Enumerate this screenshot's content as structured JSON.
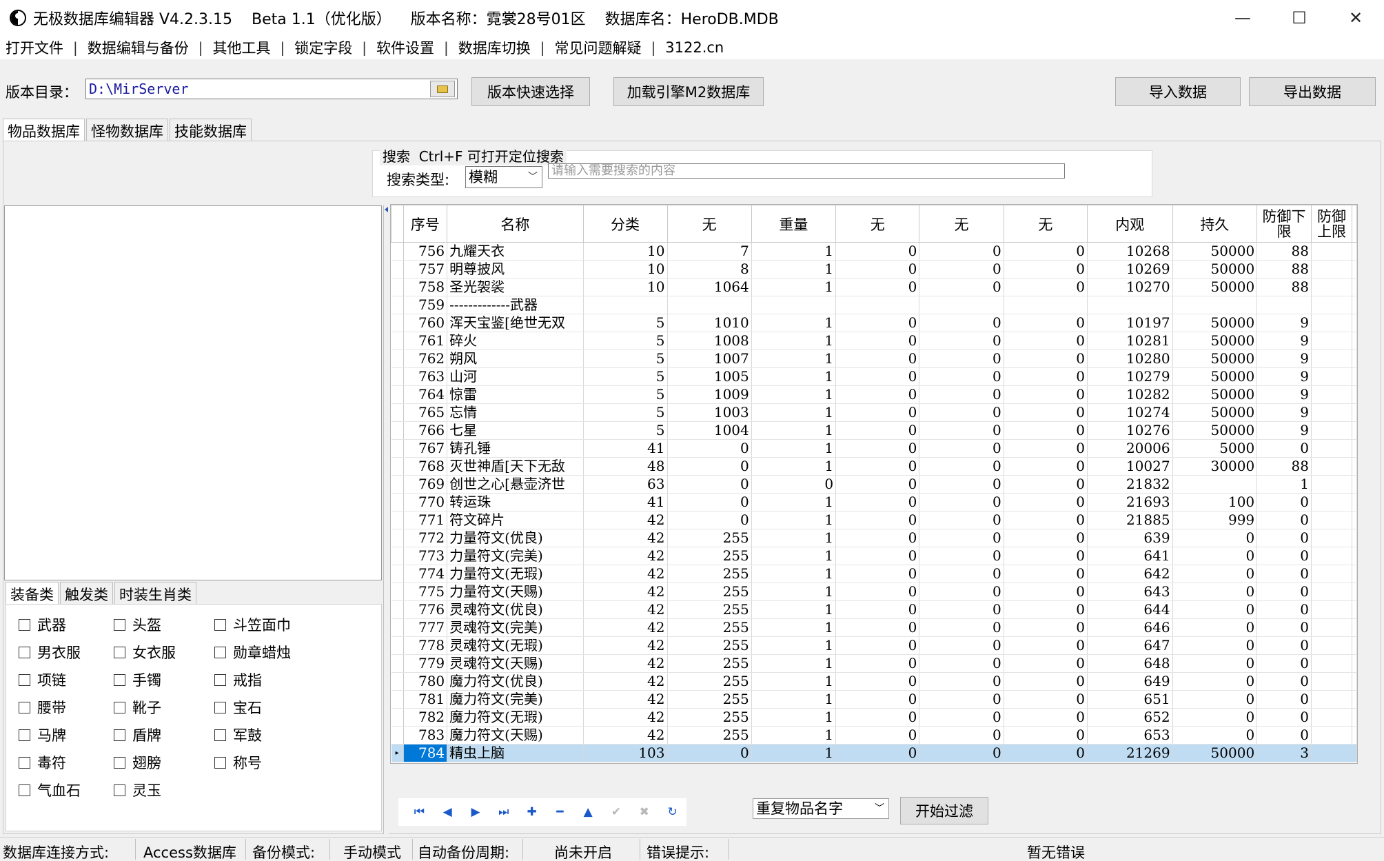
{
  "window": {
    "title": "无极数据库编辑器 V4.2.3.15    Beta 1.1（优化版）    版本名称：霓裳28号01区    数据库名：HeroDB.MDB",
    "minimize": "—",
    "maximize": "☐",
    "close": "✕"
  },
  "menu": [
    "打开文件",
    "数据编辑与备份",
    "其他工具",
    "锁定字段",
    "软件设置",
    "数据库切换",
    "常见问题解疑",
    "3122.cn"
  ],
  "toolbar": {
    "dir_label": "版本目录：",
    "dir_value": "D:\\MirServer",
    "quick_select": "版本快速选择",
    "load_m2": "加载引擎M2数据库",
    "import": "导入数据",
    "export": "导出数据"
  },
  "tabs": [
    "物品数据库",
    "怪物数据库",
    "技能数据库"
  ],
  "search": {
    "title": "搜索  Ctrl+F 可打开定位搜索",
    "type_label": "搜索类型:",
    "type_value": "模糊",
    "placeholder": "请输入需要搜索的内容"
  },
  "category_tabs": [
    "装备类",
    "触发类",
    "时装生肖类"
  ],
  "checkboxes": [
    "武器",
    "头盔",
    "斗笠面巾",
    "男衣服",
    "女衣服",
    "勋章蜡烛",
    "项链",
    "手镯",
    "戒指",
    "腰带",
    "靴子",
    "宝石",
    "马牌",
    "盾牌",
    "军鼓",
    "毒符",
    "翅膀",
    "称号",
    "气血石",
    "灵玉"
  ],
  "grid": {
    "headers": [
      "序号",
      "名称",
      "分类",
      "无",
      "重量",
      "无",
      "无",
      "无",
      "内观",
      "持久",
      "防御下限",
      "防御上限"
    ],
    "rows": [
      [
        "756",
        "九耀天衣",
        "10",
        "7",
        "1",
        "0",
        "0",
        "0",
        "10268",
        "50000",
        "88",
        ""
      ],
      [
        "757",
        "明尊披风",
        "10",
        "8",
        "1",
        "0",
        "0",
        "0",
        "10269",
        "50000",
        "88",
        ""
      ],
      [
        "758",
        "圣光袈裟",
        "10",
        "1064",
        "1",
        "0",
        "0",
        "0",
        "10270",
        "50000",
        "88",
        ""
      ],
      [
        "759",
        "-------------武器",
        "",
        "",
        "",
        "",
        "",
        "",
        "",
        "",
        "",
        ""
      ],
      [
        "760",
        "浑天宝鉴[绝世无双",
        "5",
        "1010",
        "1",
        "0",
        "0",
        "0",
        "10197",
        "50000",
        "9",
        ""
      ],
      [
        "761",
        "碎火",
        "5",
        "1008",
        "1",
        "0",
        "0",
        "0",
        "10281",
        "50000",
        "9",
        ""
      ],
      [
        "762",
        "朔风",
        "5",
        "1007",
        "1",
        "0",
        "0",
        "0",
        "10280",
        "50000",
        "9",
        ""
      ],
      [
        "763",
        "山河",
        "5",
        "1005",
        "1",
        "0",
        "0",
        "0",
        "10279",
        "50000",
        "9",
        ""
      ],
      [
        "764",
        "惊雷",
        "5",
        "1009",
        "1",
        "0",
        "0",
        "0",
        "10282",
        "50000",
        "9",
        ""
      ],
      [
        "765",
        "忘情",
        "5",
        "1003",
        "1",
        "0",
        "0",
        "0",
        "10274",
        "50000",
        "9",
        ""
      ],
      [
        "766",
        "七星",
        "5",
        "1004",
        "1",
        "0",
        "0",
        "0",
        "10276",
        "50000",
        "9",
        ""
      ],
      [
        "767",
        "铸孔锤",
        "41",
        "0",
        "1",
        "0",
        "0",
        "0",
        "20006",
        "5000",
        "0",
        ""
      ],
      [
        "768",
        "灭世神盾[天下无敌",
        "48",
        "0",
        "1",
        "0",
        "0",
        "0",
        "10027",
        "30000",
        "88",
        ""
      ],
      [
        "769",
        "创世之心[悬壶济世",
        "63",
        "0",
        "0",
        "0",
        "0",
        "0",
        "21832",
        "",
        "1",
        ""
      ],
      [
        "770",
        "转运珠",
        "41",
        "0",
        "1",
        "0",
        "0",
        "0",
        "21693",
        "100",
        "0",
        ""
      ],
      [
        "771",
        "符文碎片",
        "42",
        "0",
        "1",
        "0",
        "0",
        "0",
        "21885",
        "999",
        "0",
        ""
      ],
      [
        "772",
        "力量符文(优良)",
        "42",
        "255",
        "1",
        "0",
        "0",
        "0",
        "639",
        "0",
        "0",
        ""
      ],
      [
        "773",
        "力量符文(完美)",
        "42",
        "255",
        "1",
        "0",
        "0",
        "0",
        "641",
        "0",
        "0",
        ""
      ],
      [
        "774",
        "力量符文(无瑕)",
        "42",
        "255",
        "1",
        "0",
        "0",
        "0",
        "642",
        "0",
        "0",
        ""
      ],
      [
        "775",
        "力量符文(天赐)",
        "42",
        "255",
        "1",
        "0",
        "0",
        "0",
        "643",
        "0",
        "0",
        ""
      ],
      [
        "776",
        "灵魂符文(优良)",
        "42",
        "255",
        "1",
        "0",
        "0",
        "0",
        "644",
        "0",
        "0",
        ""
      ],
      [
        "777",
        "灵魂符文(完美)",
        "42",
        "255",
        "1",
        "0",
        "0",
        "0",
        "646",
        "0",
        "0",
        ""
      ],
      [
        "778",
        "灵魂符文(无瑕)",
        "42",
        "255",
        "1",
        "0",
        "0",
        "0",
        "647",
        "0",
        "0",
        ""
      ],
      [
        "779",
        "灵魂符文(天赐)",
        "42",
        "255",
        "1",
        "0",
        "0",
        "0",
        "648",
        "0",
        "0",
        ""
      ],
      [
        "780",
        "魔力符文(优良)",
        "42",
        "255",
        "1",
        "0",
        "0",
        "0",
        "649",
        "0",
        "0",
        ""
      ],
      [
        "781",
        "魔力符文(完美)",
        "42",
        "255",
        "1",
        "0",
        "0",
        "0",
        "651",
        "0",
        "0",
        ""
      ],
      [
        "782",
        "魔力符文(无瑕)",
        "42",
        "255",
        "1",
        "0",
        "0",
        "0",
        "652",
        "0",
        "0",
        ""
      ],
      [
        "783",
        "魔力符文(天赐)",
        "42",
        "255",
        "1",
        "0",
        "0",
        "0",
        "653",
        "0",
        "0",
        ""
      ],
      [
        "784",
        "精虫上脑",
        "103",
        "0",
        "1",
        "0",
        "0",
        "0",
        "21269",
        "50000",
        "3",
        ""
      ]
    ],
    "selected_index": 28
  },
  "navigator": [
    {
      "icon": "first-record-icon",
      "glyph": "⏮",
      "enabled": true
    },
    {
      "icon": "prior-record-icon",
      "glyph": "◀",
      "enabled": true
    },
    {
      "icon": "next-record-icon",
      "glyph": "▶",
      "enabled": true
    },
    {
      "icon": "last-record-icon",
      "glyph": "⏭",
      "enabled": true
    },
    {
      "icon": "insert-record-icon",
      "glyph": "✚",
      "enabled": true
    },
    {
      "icon": "delete-record-icon",
      "glyph": "━",
      "enabled": true
    },
    {
      "icon": "edit-record-icon",
      "glyph": "▲",
      "enabled": true
    },
    {
      "icon": "post-record-icon",
      "glyph": "✔",
      "enabled": false
    },
    {
      "icon": "cancel-record-icon",
      "glyph": "✖",
      "enabled": false
    },
    {
      "icon": "refresh-records-icon",
      "glyph": "↻",
      "enabled": true
    }
  ],
  "filter": {
    "select_value": "重复物品名字",
    "start_button": "开始过滤"
  },
  "status": {
    "conn_label": "数据库连接方式:",
    "conn_value": "Access数据库",
    "backup_label": "备份模式:",
    "backup_value": "手动模式",
    "period_label": "自动备份周期:",
    "period_value": "尚未开启",
    "error_label": "错误提示:",
    "error_value": "暂无错误"
  },
  "colors": {
    "selection_row": "#bfdcf2",
    "selection_cell": "#0078d7",
    "nav_icon": "#1b58c9"
  }
}
